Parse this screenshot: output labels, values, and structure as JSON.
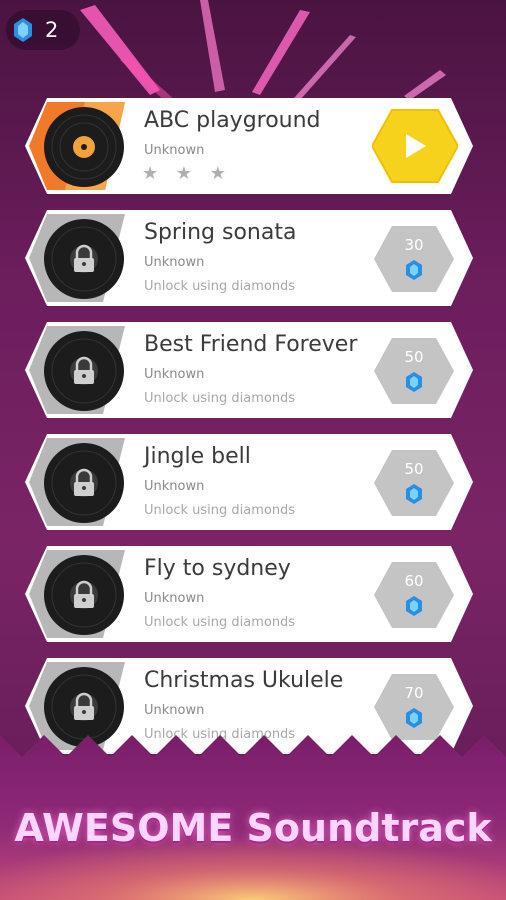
{
  "header": {
    "diamond_count": "2",
    "gem_icon": "diamond-icon"
  },
  "songs": [
    {
      "title": "ABC playground",
      "artist": "Unknown",
      "stars": "★ ★ ★",
      "state": "unlocked",
      "action_icon": "play-icon"
    },
    {
      "title": "Spring sonata",
      "artist": "Unknown",
      "status": "Unlock using diamonds",
      "price": "30",
      "state": "locked"
    },
    {
      "title": "Best Friend Forever",
      "artist": "Unknown",
      "status": "Unlock using diamonds",
      "price": "50",
      "state": "locked"
    },
    {
      "title": "Jingle bell",
      "artist": "Unknown",
      "status": "Unlock using diamonds",
      "price": "50",
      "state": "locked"
    },
    {
      "title": "Fly to sydney",
      "artist": "Unknown",
      "status": "Unlock using diamonds",
      "price": "60",
      "state": "locked"
    },
    {
      "title": "Christmas Ukulele",
      "artist": "Unknown",
      "status": "Unlock using diamonds",
      "price": "70",
      "state": "locked"
    }
  ],
  "banner": {
    "text": "AWESOME Soundtrack"
  },
  "colors": {
    "background": "#6b1d5c",
    "card": "#ffffff",
    "play_button": "#f7d21c",
    "unlocked_accent": "#f07a2a",
    "locked_accent": "#b7b7b7",
    "gem": "#2a8fe0",
    "banner_text": "#ffd6ff"
  }
}
